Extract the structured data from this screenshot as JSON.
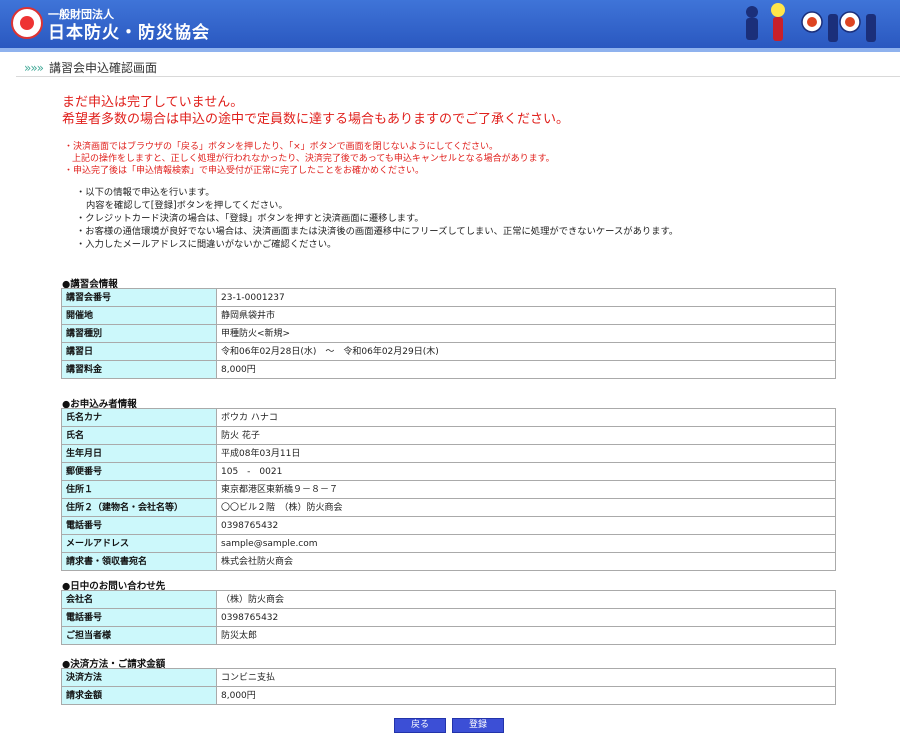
{
  "header": {
    "org_type": "一般財団法人",
    "org_name": "日本防火・防災協会"
  },
  "page_title": {
    "arrows": "»»»",
    "text": "講習会申込確認画面"
  },
  "warnings": {
    "line1": "まだ申込は完了していません。",
    "line2": "希望者多数の場合は申込の途中で定員数に達する場合もありますのでご了承ください。",
    "notes": [
      "・決済画面ではブラウザの「戻る」ボタンを押したり、「×」ボタンで画面を閉じないようにしてください。",
      "上記の操作をしますと、正しく処理が行われなかったり、決済完了後であっても申込キャンセルとなる場合があります。",
      "・申込完了後は「申込情報検索」で申込受付が正常に完了したことをお確かめください。"
    ]
  },
  "info_lines": [
    "・以下の情報で申込を行います。",
    "内容を確認して[登録]ボタンを押してください。",
    "・クレジットカード決済の場合は、「登録」ボタンを押すと決済画面に遷移します。",
    "・お客様の通信環境が良好でない場合は、決済画面または決済後の画面遷移中にフリーズしてしまい、正常に処理ができないケースがあります。",
    "・入力したメールアドレスに間違いがないかご確認ください。"
  ],
  "sections": {
    "course": {
      "title": "●講習会情報",
      "rows": [
        {
          "label": "講習会番号",
          "value": "23-1-0001237"
        },
        {
          "label": "開催地",
          "value": "静岡県袋井市"
        },
        {
          "label": "講習種別",
          "value": "甲種防火<新規>"
        },
        {
          "label": "講習日",
          "value": "令和06年02月28日(水)　～　令和06年02月29日(木)"
        },
        {
          "label": "講習料金",
          "value": "8,000円"
        }
      ]
    },
    "applicant": {
      "title": "●お申込み者情報",
      "rows": [
        {
          "label": "氏名カナ",
          "value": "ボウカ ハナコ"
        },
        {
          "label": "氏名",
          "value": "防火 花子"
        },
        {
          "label": "生年月日",
          "value": "平成08年03月11日"
        },
        {
          "label": "郵便番号",
          "value": "105　-　0021"
        },
        {
          "label": "住所１",
          "value": "東京都港区東新橋９－８－７"
        },
        {
          "label": "住所２（建物名・会社名等）",
          "value": "〇〇ビル２階　（株）防火商会"
        },
        {
          "label": "電話番号",
          "value": "0398765432"
        },
        {
          "label": "メールアドレス",
          "value": "sample@sample.com"
        },
        {
          "label": "請求書・領収書宛名",
          "value": "株式会社防火商会"
        }
      ]
    },
    "contact": {
      "title": "●日中のお問い合わせ先",
      "rows": [
        {
          "label": "会社名",
          "value": "（株）防火商会"
        },
        {
          "label": "電話番号",
          "value": "0398765432"
        },
        {
          "label": "ご担当者様",
          "value": "防災太郎"
        }
      ]
    },
    "payment": {
      "title": "●決済方法・ご請求金額",
      "rows": [
        {
          "label": "決済方法",
          "value": "コンビニ支払"
        },
        {
          "label": "請求金額",
          "value": "8,000円"
        }
      ]
    }
  },
  "buttons": {
    "back": "戻る",
    "submit": "登録"
  }
}
